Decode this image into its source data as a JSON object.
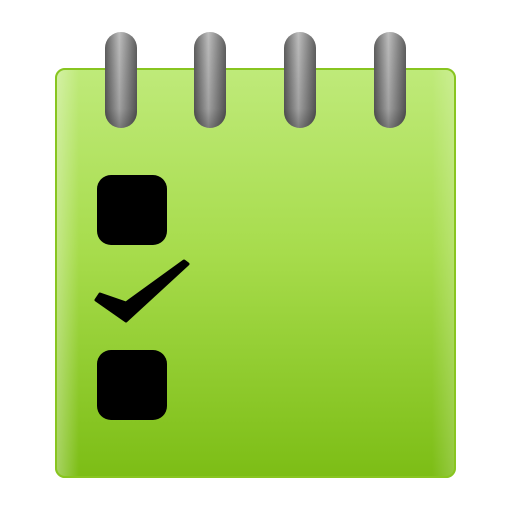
{
  "icon": {
    "name": "checklist-notepad-icon",
    "colors": {
      "pad_top": "#bfea7a",
      "pad_mid": "#a7dc4c",
      "pad_bottom": "#7cbd15",
      "pad_edge": "#88c520",
      "ring_light": "#bdbdbd",
      "ring_dark": "#5f5f5f",
      "mark": "#000000"
    },
    "rings": 4,
    "items": [
      {
        "state": "unchecked"
      },
      {
        "state": "checked"
      },
      {
        "state": "unchecked"
      }
    ]
  }
}
